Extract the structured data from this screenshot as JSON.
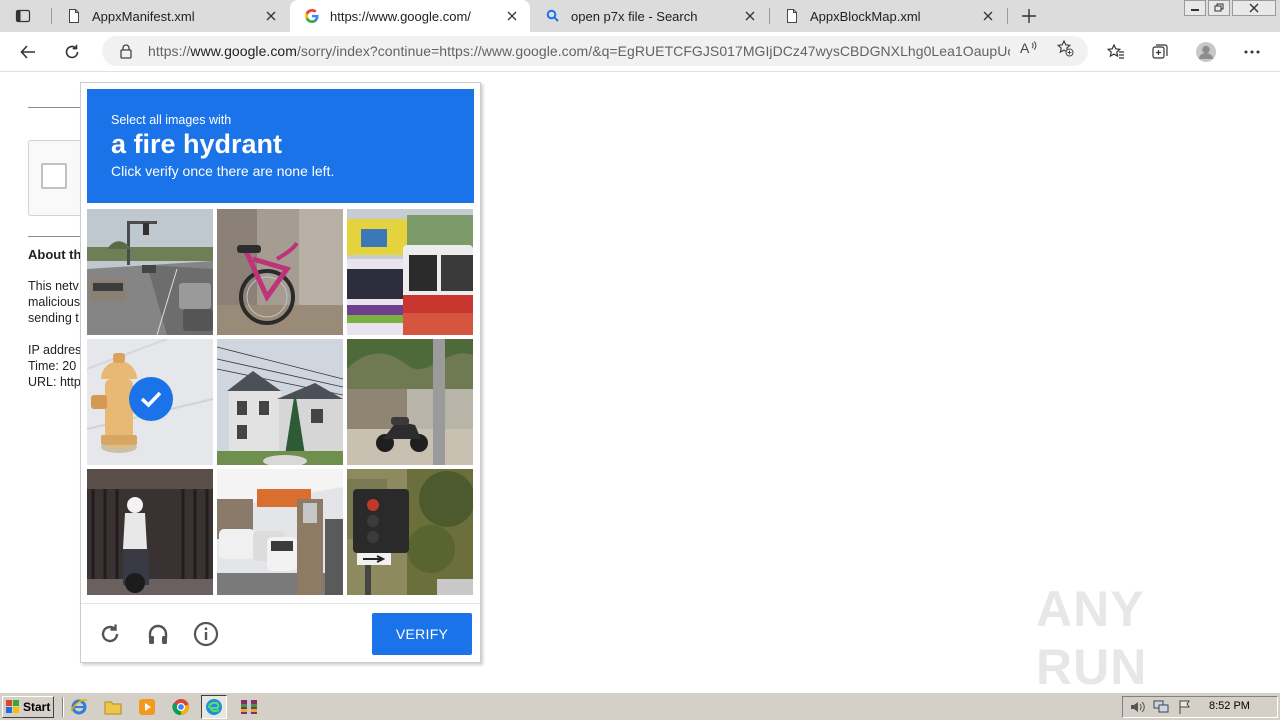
{
  "browser": {
    "tabs": [
      {
        "label": "AppxManifest.xml",
        "icon": "document-icon",
        "active": false
      },
      {
        "label": "https://www.google.com/",
        "icon": "google-icon",
        "active": true
      },
      {
        "label": "open p7x file - Search",
        "icon": "search-icon",
        "active": false
      },
      {
        "label": "AppxBlockMap.xml",
        "icon": "document-icon",
        "active": false
      }
    ],
    "address": {
      "prefix": "https://",
      "domain": "www.google.com",
      "path": "/sorry/index?continue=https://www.google.com/&q=EgRUETCFGJS017MGIjDCz47wysCBDGNXLhg0Lea1OaupUoE..."
    }
  },
  "page": {
    "heading": "About th",
    "para_lines": [
      "This netv",
      "malicious",
      "sending t"
    ],
    "info_lines": [
      "IP addres",
      "Time: 20",
      "URL: http"
    ]
  },
  "captcha": {
    "line1": "Select all images with",
    "line2": "a fire hydrant",
    "line3": "Click verify once there are none left.",
    "tiles": [
      {
        "subject": "street intersection with cars",
        "selected": false
      },
      {
        "subject": "pink bicycle",
        "selected": false
      },
      {
        "subject": "buses",
        "selected": false
      },
      {
        "subject": "fire hydrant",
        "selected": true
      },
      {
        "subject": "house with power lines",
        "selected": false
      },
      {
        "subject": "motorcycle by pole",
        "selected": false
      },
      {
        "subject": "motorcyclist at gate",
        "selected": false
      },
      {
        "subject": "parked cars",
        "selected": false
      },
      {
        "subject": "traffic light",
        "selected": false
      }
    ],
    "verify_label": "VERIFY"
  },
  "watermark": "ANY RUN",
  "taskbar": {
    "start_label": "Start",
    "clock": "8:52 PM"
  },
  "colors": {
    "accent": "#1a73e8",
    "tabstrip": "#dcdcdc",
    "taskbar": "#d4d0c8"
  }
}
